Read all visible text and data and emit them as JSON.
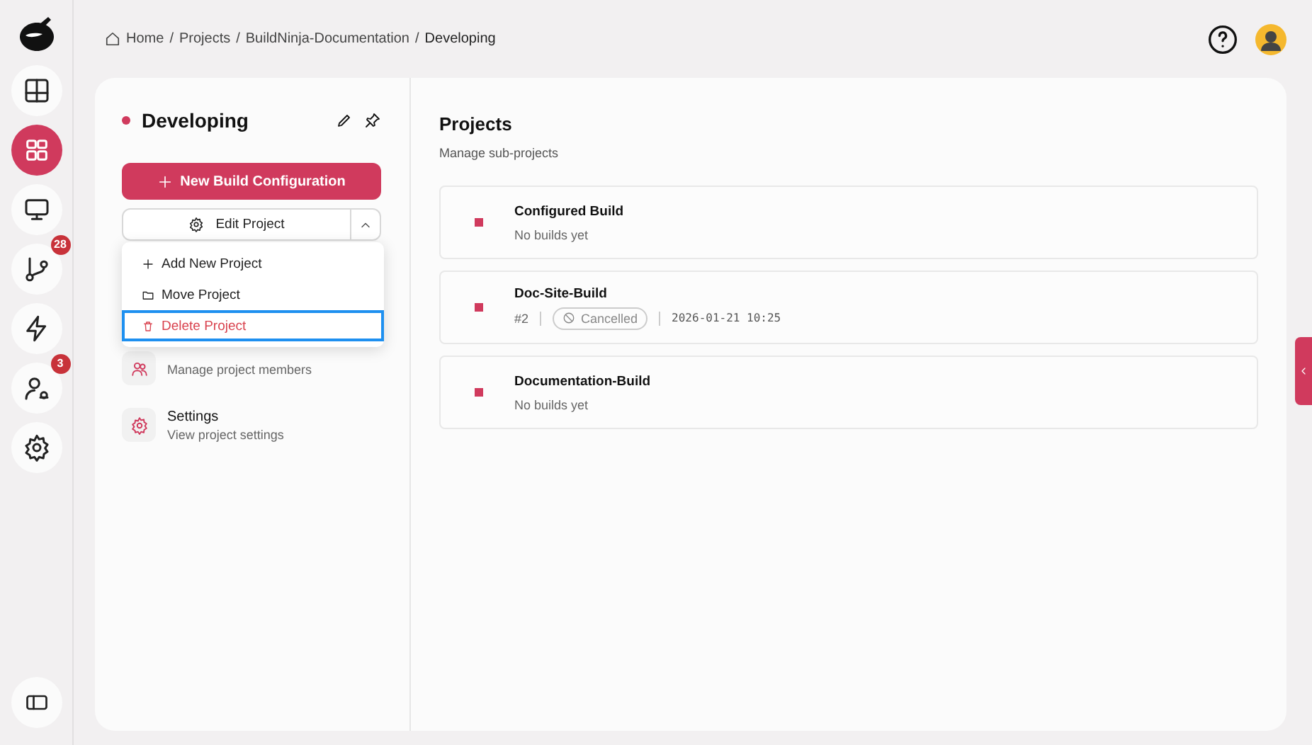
{
  "rail": {
    "items": [
      {
        "kind": "layout",
        "selected": false
      },
      {
        "kind": "dashboard",
        "selected": true
      },
      {
        "kind": "monitor",
        "selected": false
      },
      {
        "kind": "branch",
        "selected": false,
        "badge": "28"
      },
      {
        "kind": "bolt",
        "selected": false
      },
      {
        "kind": "user-gear",
        "selected": false,
        "badge": "3"
      },
      {
        "kind": "gear",
        "selected": false
      }
    ]
  },
  "breadcrumb": [
    "Home",
    "Projects",
    "BuildNinja-Documentation",
    "Developing"
  ],
  "breadcrumb_separator": "/",
  "sidebar": {
    "title": "Developing",
    "primary_button": "New Build Configuration",
    "split_button": "Edit Project",
    "menu": [
      {
        "kind": "add",
        "label": "Add New Project",
        "highlighted": false,
        "danger": false
      },
      {
        "kind": "move",
        "label": "Move Project",
        "highlighted": false,
        "danger": false
      },
      {
        "kind": "delete",
        "label": "Delete Project",
        "highlighted": true,
        "danger": true
      }
    ],
    "nav": [
      {
        "kind": "members",
        "description": "Manage project members"
      },
      {
        "kind": "settings",
        "title": "Settings",
        "description": "View project settings"
      }
    ]
  },
  "content": {
    "title": "Projects",
    "subtitle": "Manage sub-projects",
    "projects": [
      {
        "name": "Configured Build",
        "summary": "No builds yet"
      },
      {
        "name": "Doc-Site-Build",
        "build_number": "#2",
        "status": "Cancelled",
        "time": "2026-01-21 10:25"
      },
      {
        "name": "Documentation-Build",
        "summary": "No builds yet"
      }
    ]
  }
}
